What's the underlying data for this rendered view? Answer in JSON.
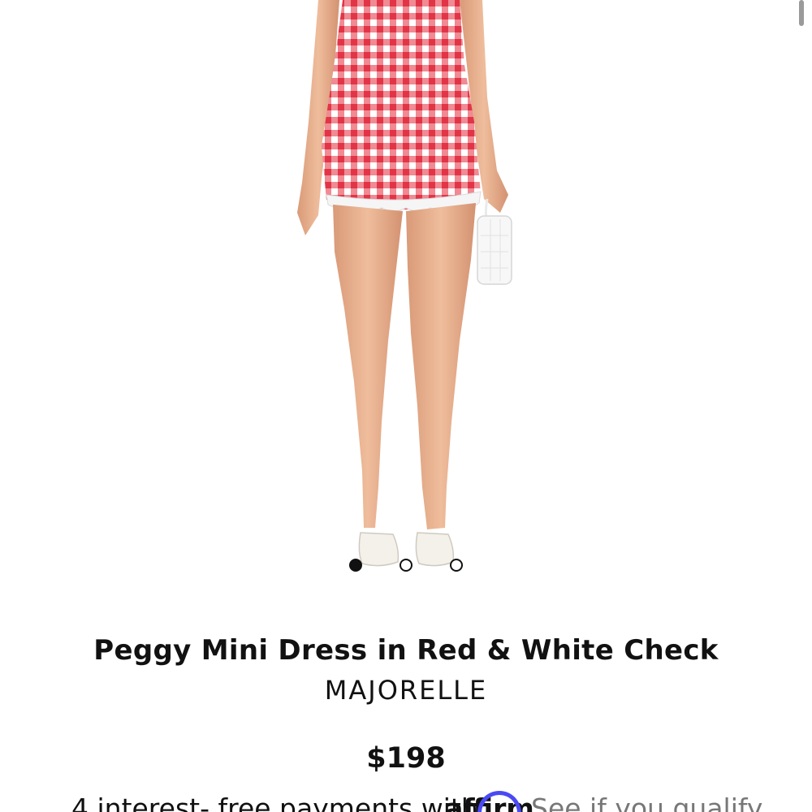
{
  "product": {
    "image_alt": "Model wearing red and white gingham mini dress",
    "title": "Peggy Mini Dress in Red & White Check",
    "brand": "MAJORELLE",
    "price": "$198"
  },
  "carousel": {
    "slide_count": 3,
    "active_index": 0
  },
  "payments": {
    "text": "4 interest- free payments with",
    "provider": "affirm",
    "qualify_link": "See if you qualify"
  },
  "colors": {
    "gingham_red": "#e8404f",
    "affirm_blue": "#4a4af4",
    "text": "#111111"
  }
}
